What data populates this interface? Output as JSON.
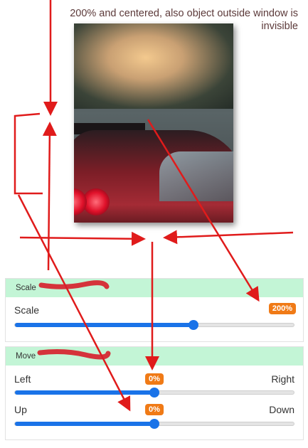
{
  "caption": "200% and centered, also object outside window is invisible",
  "scale_panel": {
    "title": "Scale",
    "slider": {
      "label": "Scale",
      "value_text": "200%",
      "fraction": 0.64
    }
  },
  "move_panel": {
    "title": "Move",
    "slider_x": {
      "left_label": "Left",
      "right_label": "Right",
      "value_text": "0%",
      "fraction": 0.5
    },
    "slider_y": {
      "left_label": "Up",
      "right_label": "Down",
      "value_text": "0%",
      "fraction": 0.5
    }
  },
  "accent_colors": {
    "header": "#c3f5d6",
    "slider": "#1a73e8",
    "badge": "#f07a16",
    "arrows": "#e01b1b"
  }
}
